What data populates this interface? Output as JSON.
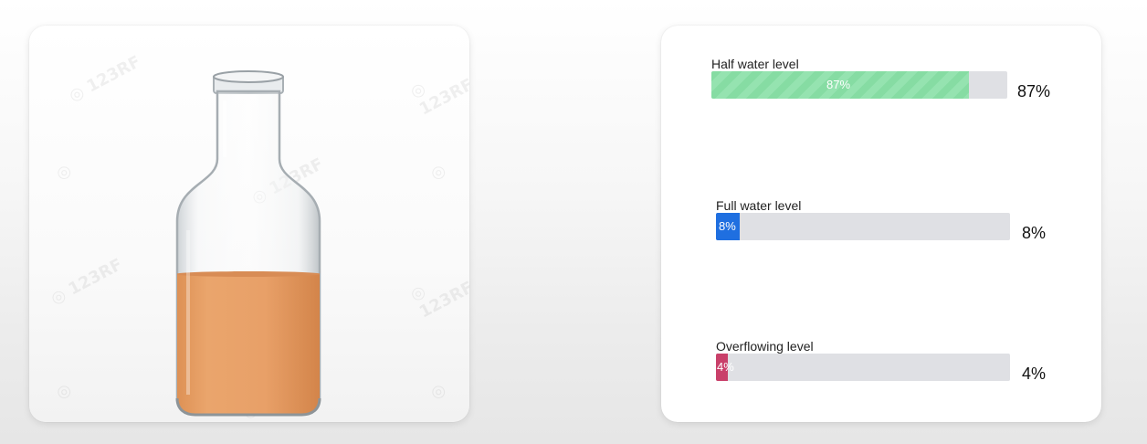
{
  "poll": {
    "options": [
      {
        "label": "Half water level",
        "percent_text": "87%",
        "bar_text": "87%",
        "percent": 87,
        "color": "#86dca3"
      },
      {
        "label": "Full water level",
        "percent_text": "8%",
        "bar_text": "8%",
        "percent": 8,
        "color": "#1f6fe0"
      },
      {
        "label": "Overflowing level",
        "percent_text": "4%",
        "bar_text": "4%",
        "percent": 4,
        "color": "#c9406a"
      }
    ]
  },
  "colors": {
    "liquid": "#e39a5f",
    "track": "#dfe0e4"
  },
  "image": {
    "icon": "glass-bottle-with-orange-liquid"
  }
}
